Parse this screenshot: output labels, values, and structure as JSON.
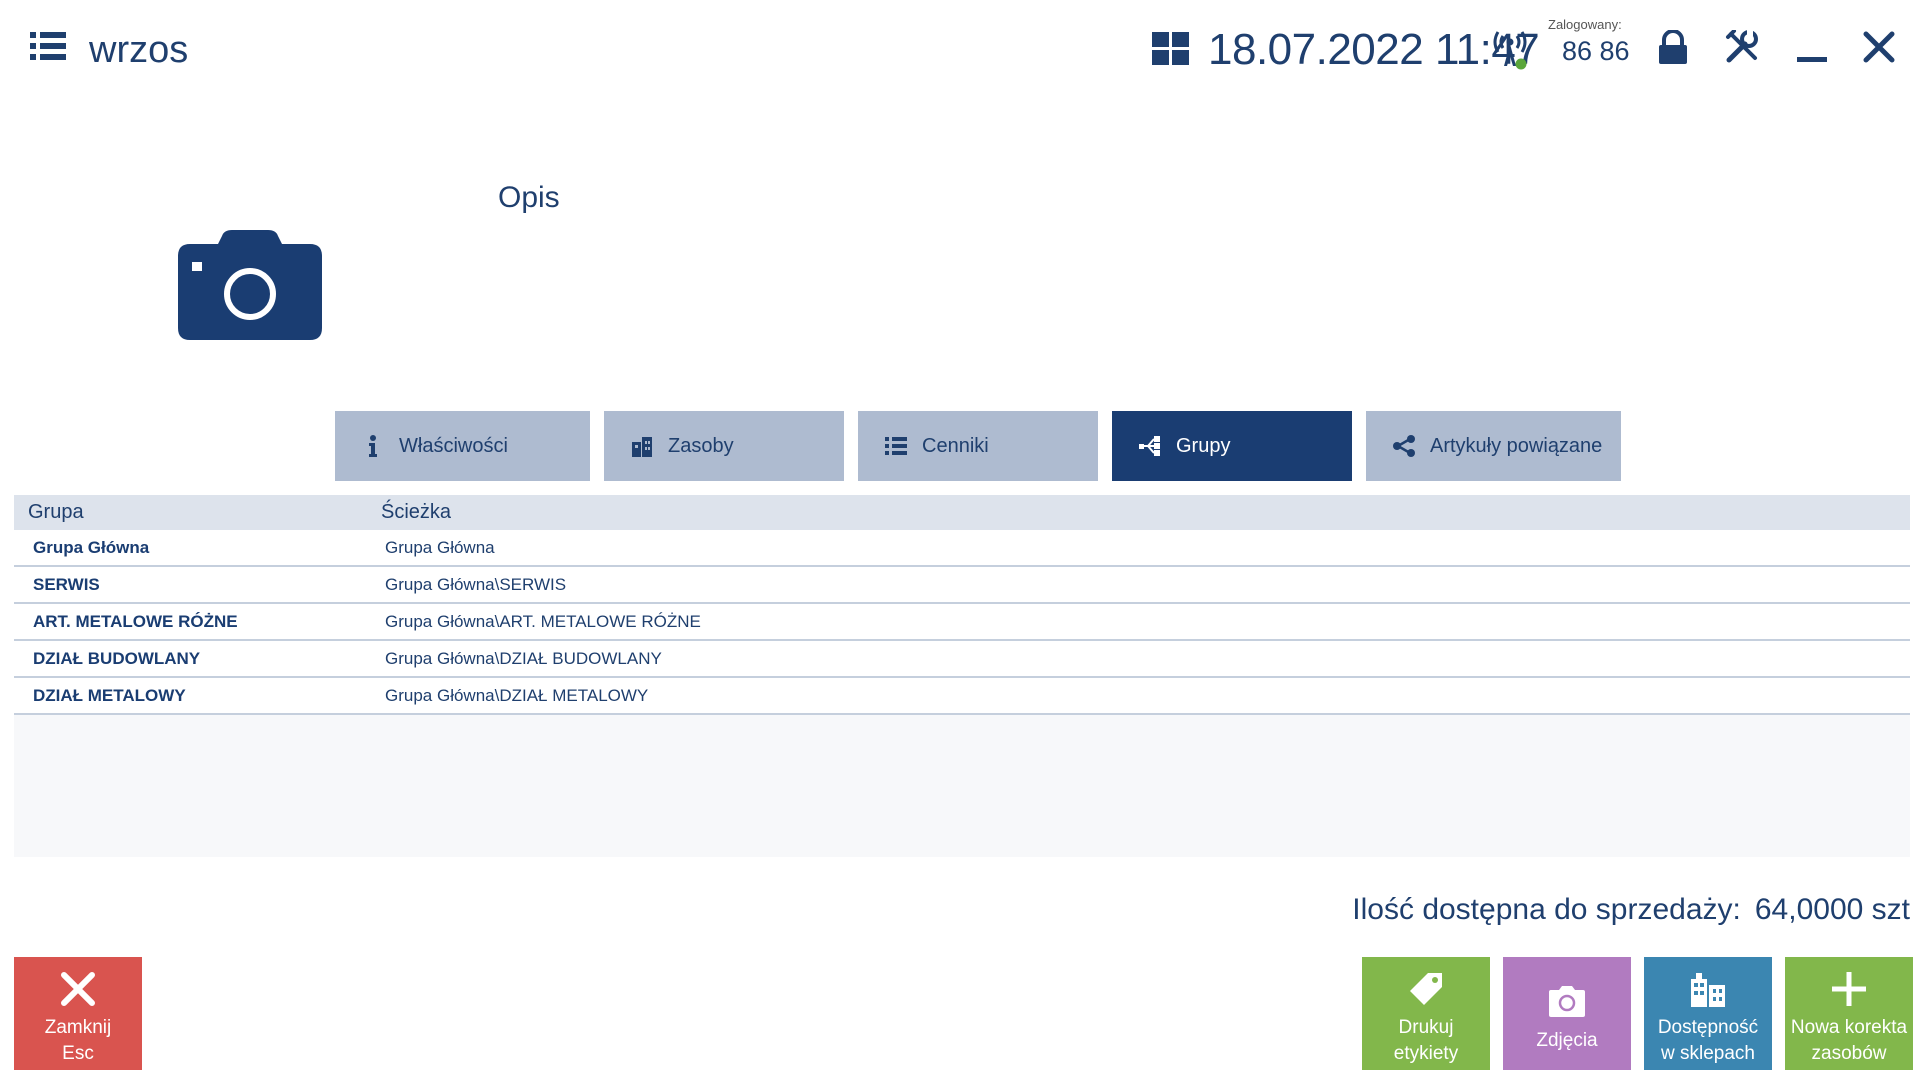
{
  "header": {
    "title": "wrzos",
    "datetime": "18.07.2022 11:47",
    "logged_label": "Zalogowany:",
    "logged_user": "86 86",
    "icons": [
      "menu-icon",
      "windows-icon",
      "signal-icon",
      "lock-icon",
      "tools-icon",
      "minimize-icon",
      "close-icon"
    ]
  },
  "photo": {
    "opis_label": "Opis",
    "icon": "camera-icon"
  },
  "tabs": [
    {
      "label": "Właściwości",
      "icon": "info-icon",
      "active": false
    },
    {
      "label": "Zasoby",
      "icon": "buildings-icon",
      "active": false
    },
    {
      "label": "Cenniki",
      "icon": "list-icon",
      "active": false
    },
    {
      "label": "Grupy",
      "icon": "tree-icon",
      "active": true
    },
    {
      "label": "Artykuły powiązane",
      "icon": "share-icon",
      "active": false
    }
  ],
  "table": {
    "columns": [
      "Grupa",
      "Ścieżka"
    ],
    "rows": [
      {
        "grupa": "Grupa Główna",
        "sciezka": "Grupa Główna"
      },
      {
        "grupa": "SERWIS",
        "sciezka": "Grupa Główna\\SERWIS"
      },
      {
        "grupa": "ART. METALOWE RÓŻNE",
        "sciezka": "Grupa Główna\\ART. METALOWE RÓŻNE"
      },
      {
        "grupa": "DZIAŁ BUDOWLANY",
        "sciezka": "Grupa Główna\\DZIAŁ BUDOWLANY"
      },
      {
        "grupa": "DZIAŁ METALOWY",
        "sciezka": "Grupa Główna\\DZIAŁ METALOWY"
      }
    ]
  },
  "availability": {
    "label": "Ilość dostępna do sprzedaży:",
    "value": "64,0000 szt"
  },
  "buttons": {
    "close": {
      "line1": "Zamknij",
      "line2": "Esc"
    },
    "print": {
      "line1": "Drukuj",
      "line2": "etykiety"
    },
    "photo": {
      "line1": "Zdjęcia"
    },
    "stores": {
      "line1": "Dostępność",
      "line2": "w sklepach"
    },
    "new_correction": {
      "line1": "Nowa korekta",
      "line2": "zasobów"
    }
  },
  "colors": {
    "primary": "#1a3d72",
    "tab_inactive": "#aebbd0",
    "close_red": "#d9544f",
    "green": "#82b74b",
    "purple": "#b17bc0",
    "blue": "#3b86b1",
    "online_dot": "#5aa63a"
  }
}
